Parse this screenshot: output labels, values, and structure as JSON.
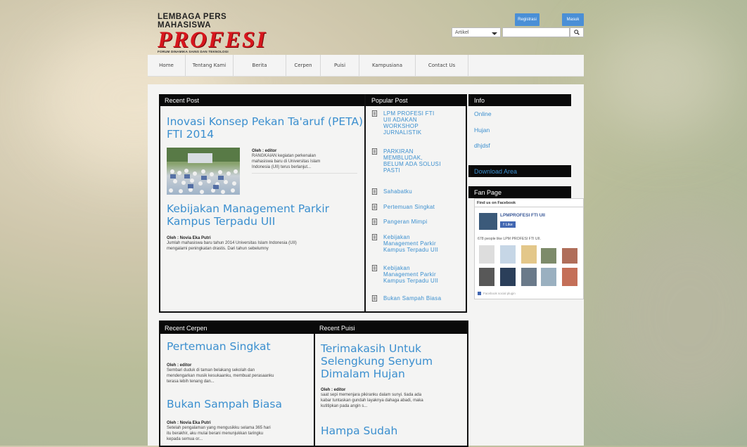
{
  "header": {
    "logo_top": "LEMBAGA PERS MAHASISWA",
    "logo_main": "PROFESI",
    "logo_sub": "FORUM DINAMIKA SAINS DAN TEKNOLOGI",
    "register_label": "Registrasi",
    "login_label": "Masuk",
    "search_category": "Artikel",
    "search_placeholder": ""
  },
  "nav": [
    {
      "label": "Home"
    },
    {
      "label": "Tentang Kami"
    },
    {
      "label": "Berita"
    },
    {
      "label": "Cerpen"
    },
    {
      "label": "Puisi"
    },
    {
      "label": "Kampusiana"
    },
    {
      "label": "Contact Us"
    }
  ],
  "recent_post": {
    "heading": "Recent Post",
    "posts": [
      {
        "title_l1": "Inovasi Konsep Pekan Ta'aruf (PETA)",
        "title_l2": "FTI 2014",
        "author": "Oleh : editor",
        "excerpt_l1": "RANGKAIAN kegiatan perkenalan",
        "excerpt_l2": "mahasiswa baru di Universitas Islam",
        "excerpt_l3": "Indonesia (UII) terus berlanjut..."
      },
      {
        "title_l1": "Kebijakan Management Parkir",
        "title_l2": "Kampus Terpadu UII",
        "author": "Oleh : Novia Eka Putri",
        "excerpt_l1": "Jumlah mahasiswa baru tahun 2014 Universitas Islam Indonesia (UII)",
        "excerpt_l2": "mengalami peningkatan drastis. Dari tahun sebelumny"
      }
    ]
  },
  "popular_post": {
    "heading": "Popular Post",
    "items": [
      {
        "l1": "LPM PROFESI FTI",
        "l2": "UII ADAKAN",
        "l3": "WORKSHOP",
        "l4": "JURNALISTIK"
      },
      {
        "l1": "PARKIRAN",
        "l2": "MEMBLUDAK,",
        "l3": "BELUM ADA SOLUSI",
        "l4": "PASTI"
      },
      {
        "l1": "Sahabatku"
      },
      {
        "l1": "Pertemuan Singkat"
      },
      {
        "l1": "Pangeran Mimpi"
      },
      {
        "l1": "Kebijakan",
        "l2": "Management Parkir",
        "l3": "Kampus Terpadu UII"
      },
      {
        "l1": "Kebijakan",
        "l2": "Management Parkir",
        "l3": "Kampus Terpadu UII"
      },
      {
        "l1": "Bukan Sampah Biasa"
      }
    ]
  },
  "sidebar": {
    "info_heading": "Info",
    "info_links": [
      "Online",
      "Hujan",
      "dhjdsf"
    ],
    "download_heading": "Download Area",
    "fanpage_heading": "Fan Page",
    "fb_find": "Find us on Facebook",
    "fb_page_name": "LPMPROFESI FTI UII",
    "fb_like": "Like",
    "fb_count": "678 people like LPM PROFESI FTI UII.",
    "fb_plugin": "Facebook social plugin"
  },
  "recent_cerpen": {
    "heading": "Recent Cerpen",
    "posts": [
      {
        "title": "Pertemuan Singkat",
        "author": "Oleh : editor",
        "excerpt_l1": "Sembari duduk di taman belakang sekolah dan",
        "excerpt_l2": "mendengarkan musik kesukaanku, membuat perasaanku",
        "excerpt_l3": "terasa lebih tenang dan..."
      },
      {
        "title": "Bukan Sampah Biasa",
        "author": "Oleh : Novia Eka Putri",
        "excerpt_l1": "Setelah pengalaman yang mengusikku selama 365 hari",
        "excerpt_l2": "itu berakhir, aku mulai berani menunjukkan taringku",
        "excerpt_l3": "kepada semua or..."
      }
    ]
  },
  "recent_puisi": {
    "heading": "Recent Puisi",
    "posts": [
      {
        "title_l1": "Terimakasih Untuk",
        "title_l2": "Selengkung Senyum",
        "title_l3": "Dimalam Hujan",
        "author": "Oleh : editor",
        "excerpt_l1": "saat sepi memenjara pikiranku dalam sunyi. tiada ada",
        "excerpt_l2": "kabar tuntaskan gundah layaknya dahaga abadi, maka",
        "excerpt_l3": "kutitipkan pada angin s..."
      },
      {
        "title_l1": "Hampa Sudah"
      }
    ]
  },
  "colors": {
    "accent": "#3b8fcf",
    "logo_red": "#d7161d",
    "bar": "#0a0a0a",
    "button": "#4a8fd6"
  }
}
